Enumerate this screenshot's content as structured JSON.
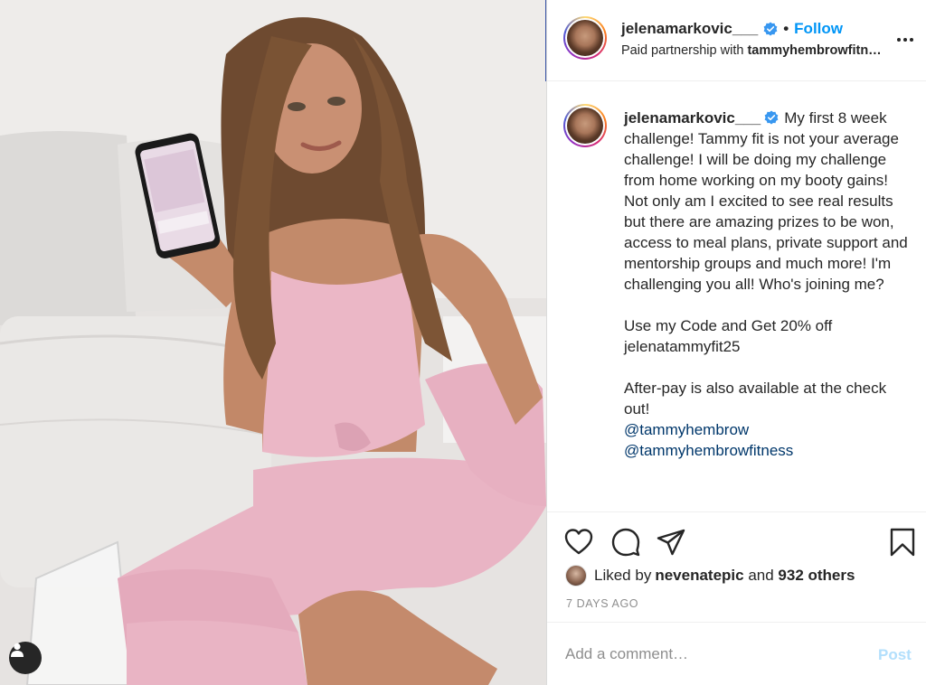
{
  "post": {
    "username": "jelenamarkovic___",
    "follow_label": "Follow",
    "dot": "•",
    "partnership_prefix": "Paid partnership with ",
    "partner": "tammyhembrowfitn…",
    "caption_body": "My first 8 week challenge! Tammy fit is not your average challenge! I will be doing my challenge from home working on my booty gains! Not only am I excited to see real results but there are amazing prizes to be won, access to meal plans, private support and mentorship groups and much more! I'm challenging you all! Who's joining me?\n\nUse my Code and Get 20% off jelenatammyfit25\n\nAfter-pay is also available at the check out!",
    "mentions": [
      "@tammyhembrow",
      "@tammyhembrowfitness"
    ],
    "liked_prefix": "Liked by ",
    "liked_user": "nevenatepic",
    "liked_middle": " and ",
    "liked_count": "932 others",
    "date": "7 DAYS AGO",
    "comment_placeholder": "Add a comment…",
    "post_label": "Post"
  },
  "icons": {
    "verified": "verified-badge-icon",
    "more": "more-options-icon",
    "like": "heart-icon",
    "comment": "comment-icon",
    "share": "share-icon",
    "save": "bookmark-icon",
    "user_tag": "user-tag-icon"
  },
  "colors": {
    "link": "#0095f6",
    "mention": "#00376b",
    "muted": "#8e8e8e",
    "post_disabled": "#b2dffc",
    "outfit_pink": "#e9b4c4"
  }
}
